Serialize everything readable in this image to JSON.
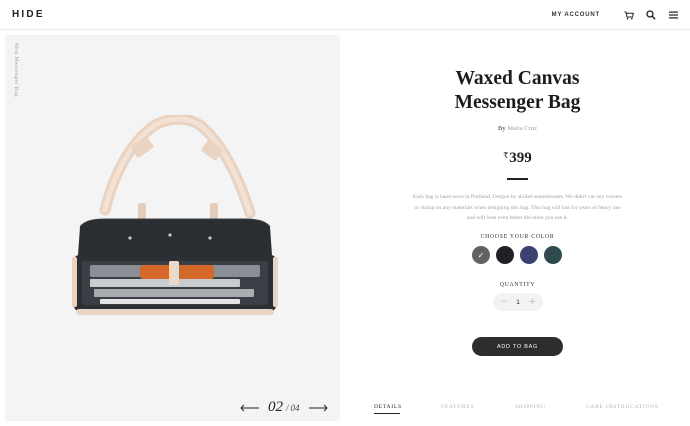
{
  "header": {
    "logo": "HIDE",
    "account_label": "MY ACCOUNT",
    "icons": [
      "cart-icon",
      "search-icon",
      "menu-icon"
    ]
  },
  "gallery": {
    "category_label": "Men Messenger Bag",
    "current_page": "02",
    "separator": "/",
    "total_pages": "04"
  },
  "product": {
    "title_line1": "Waxed Canvas",
    "title_line2": "Messenger Bag",
    "by_label": "By",
    "author": "Maria Cruz",
    "currency": "₹",
    "price": "399",
    "description": "Each bag is hand sewn in Portland, Oregon by skilled seamstresses. We didn't cut any corners or skimp on any materials when designing this bag. This bag will last for years of heavy use and will look even better the more you use it.",
    "color_label": "CHOOSE YOUR COLOR",
    "colors": [
      "#5f6366",
      "#1f2124",
      "#3b4272",
      "#2f4a4f"
    ],
    "selected_color_index": 0,
    "quantity_label": "QUANTITY",
    "quantity": "1",
    "add_to_bag_label": "ADD TO BAG"
  },
  "tabs": [
    {
      "label": "DETAILS",
      "active": true
    },
    {
      "label": "FEATURES",
      "active": false
    },
    {
      "label": "SHIPPING",
      "active": false
    },
    {
      "label": "CARE INSTRUCATIONS",
      "active": false
    }
  ]
}
